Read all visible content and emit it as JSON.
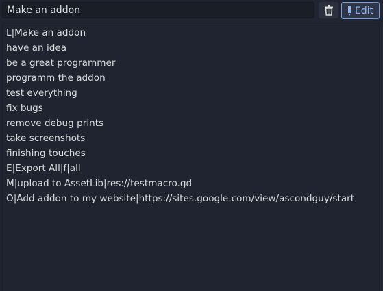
{
  "header": {
    "title_value": "Make an addon",
    "delete_icon": "trash-icon",
    "edit_icon": "pencil-icon",
    "edit_label": "Edit"
  },
  "colors": {
    "background": "#202531",
    "field_background": "#1a1e27",
    "accent": "#8cb4f2",
    "text": "#dcdcdc"
  },
  "content": {
    "lines": [
      "L|Make an addon",
      "have an idea",
      "be a great programmer",
      "programm the addon",
      "test everything",
      "fix bugs",
      "remove debug prints",
      "take screenshots",
      "finishing touches",
      "E|Export All|f|all",
      "M|upload to AssetLib|res://testmacro.gd",
      "O|Add addon to my website|https://sites.google.com/view/ascondguy/start"
    ]
  }
}
